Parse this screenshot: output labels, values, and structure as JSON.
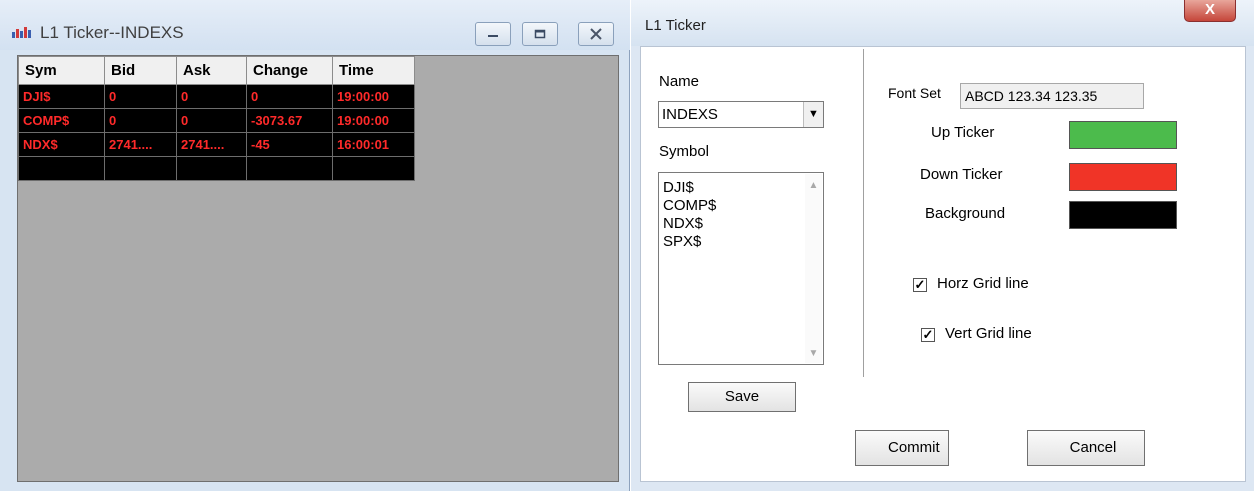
{
  "ticker_window": {
    "title": "L1 Ticker--INDEXS",
    "columns": [
      "Sym",
      "Bid",
      "Ask",
      "Change",
      "Time"
    ],
    "rows": [
      [
        "DJI$",
        "0",
        "0",
        "0",
        "19:00:00"
      ],
      [
        "COMP$",
        "0",
        "0",
        "-3073.67",
        "19:00:00"
      ],
      [
        "NDX$",
        "2741....",
        "2741....",
        "-45",
        "16:00:01"
      ],
      [
        "",
        "",
        "",
        "",
        ""
      ]
    ]
  },
  "settings_dialog": {
    "title": "L1 Ticker",
    "close_glyph": "X",
    "name_label": "Name",
    "name_value": "INDEXS",
    "symbol_label": "Symbol",
    "symbols": [
      "DJI$",
      "COMP$",
      "NDX$",
      "SPX$"
    ],
    "save_label": "Save",
    "font_set_label": "Font Set",
    "font_sample": "ABCD 123.34 123.35",
    "up_label": "Up Ticker",
    "down_label": "Down Ticker",
    "bg_label": "Background",
    "horz_label": "Horz Grid line",
    "horz_checked": true,
    "vert_label": "Vert Grid line",
    "vert_checked": true,
    "commit_label": "Commit",
    "cancel_label": "Cancel"
  },
  "colors": {
    "up": "#4cbb4c",
    "down": "#f03427",
    "background": "#000000",
    "grid_text": "#ff2a2a"
  }
}
